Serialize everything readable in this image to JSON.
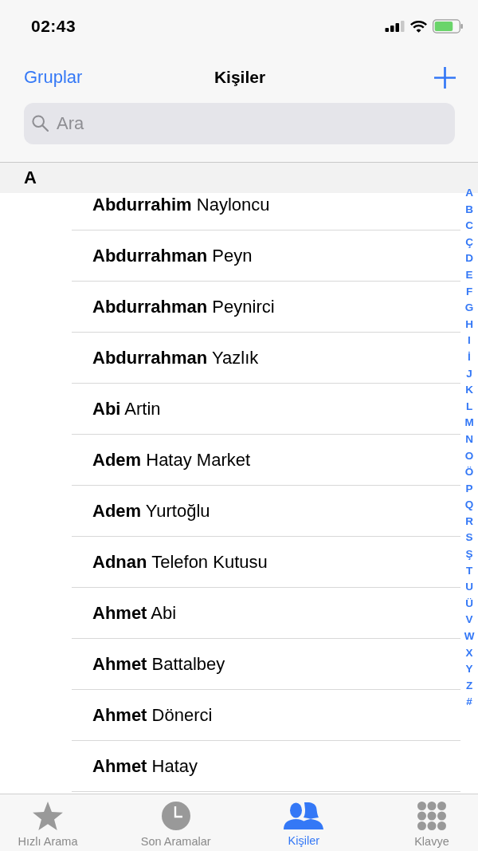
{
  "status_bar": {
    "time": "02:43"
  },
  "nav_bar": {
    "left_button": "Gruplar",
    "title": "Kişiler"
  },
  "search": {
    "placeholder": "Ara"
  },
  "sections": [
    {
      "letter": "A",
      "contacts": [
        "**Abdurrahim** Nayloncu",
        "**Abdurrahman** Peyn",
        "**Abdurrahman** Peynirci",
        "**Abdurrahman** Yazlık",
        "**Abi** Artin",
        "**Adem** Hatay Market",
        "**Adem** Yurtoğlu",
        "**Adnan** Telefon Kutusu",
        "**Ahmet** Abi",
        "**Ahmet** Battalbey",
        "**Ahmet** Dönerci",
        "**Ahmet** Hatay"
      ]
    }
  ],
  "index": [
    "A",
    "B",
    "C",
    "Ç",
    "D",
    "E",
    "F",
    "G",
    "H",
    "I",
    "İ",
    "J",
    "K",
    "L",
    "M",
    "N",
    "O",
    "Ö",
    "P",
    "Q",
    "R",
    "S",
    "Ş",
    "T",
    "U",
    "Ü",
    "V",
    "W",
    "X",
    "Y",
    "Z",
    "#"
  ],
  "tab_bar": [
    {
      "label": "Hızlı Arama",
      "kind": "favorites",
      "selected": false
    },
    {
      "label": "Son Aramalar",
      "kind": "recents",
      "selected": false
    },
    {
      "label": "Kişiler",
      "kind": "contacts",
      "selected": true
    },
    {
      "label": "Klavye",
      "kind": "keypad",
      "selected": false
    }
  ]
}
